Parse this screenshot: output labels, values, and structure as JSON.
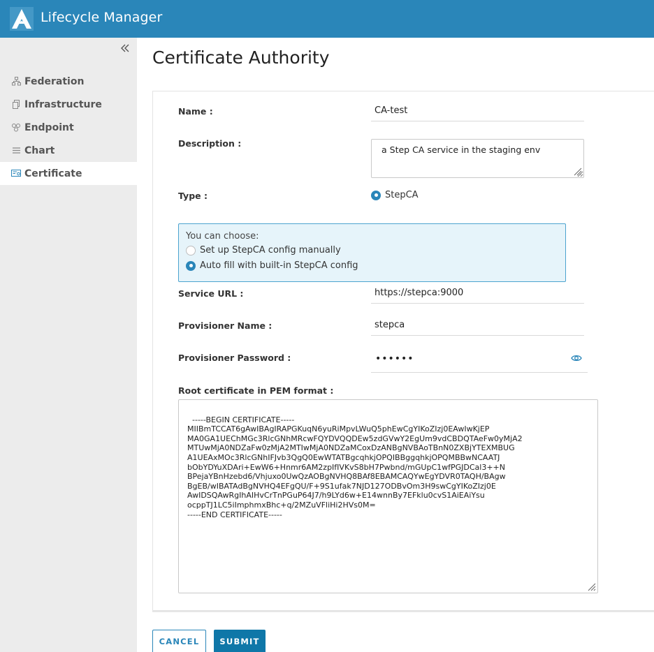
{
  "header": {
    "app_title": "Lifecycle Manager",
    "brand_color": "#2a86b9"
  },
  "sidebar": {
    "collapse_icon": "double-chevron-left-icon",
    "items": [
      {
        "label": "Federation",
        "icon": "hierarchy-icon",
        "active": false
      },
      {
        "label": "Infrastructure",
        "icon": "copy-icon",
        "active": false
      },
      {
        "label": "Endpoint",
        "icon": "endpoint-icon",
        "active": false
      },
      {
        "label": "Chart",
        "icon": "list-icon",
        "active": false
      },
      {
        "label": "Certificate",
        "icon": "certificate-icon",
        "active": true
      }
    ]
  },
  "page": {
    "title": "Certificate Authority"
  },
  "form": {
    "name_label": "Name :",
    "name_value": "CA-test",
    "description_label": "Description :",
    "description_value": "a Step CA service in the staging env",
    "type_label": "Type :",
    "type_option": "StepCA",
    "choose_title": "You can choose:",
    "choose_options": [
      {
        "label": "Set up StepCA config manually",
        "selected": false
      },
      {
        "label": "Auto fill with built-in StepCA config",
        "selected": true
      }
    ],
    "service_url_label": "Service URL :",
    "service_url_value": "https://stepca:9000",
    "provisioner_name_label": "Provisioner Name :",
    "provisioner_name_value": "stepca",
    "provisioner_password_label": "Provisioner Password :",
    "provisioner_password_value": "••••••",
    "root_cert_label": "Root certificate in PEM format :",
    "root_cert_value": "-----BEGIN CERTIFICATE-----\nMIIBmTCCAT6gAwIBAgIRAPGKuqN6yuRiMpvLWuQ5phEwCgYIKoZIzj0EAwIwKjEP\nMA0GA1UEChMGc3RlcGNhMRcwFQYDVQQDEw5zdGVwY2EgUm9vdCBDQTAeFw0yMjA2\nMTUwMjA0NDZaFw0zMjA2MTIwMjA0NDZaMCoxDzANBgNVBAoTBnN0ZXBjYTEXMBUG\nA1UEAxMOc3RlcGNhIFJvb3QgQ0EwWTATBgcqhkjOPQIBBggqhkjOPQMBBwNCAATJ\nbObYDYuXDAri+EwW6+Hnmr6AM2zpIfIVKvS8bH7Pwbnd/mGUpC1wfPGJDCal3++N\nBPejaYBnHzebd6/Vhjuxo0UwQzAOBgNVHQ8BAf8EBAMCAQYwEgYDVR0TAQH/BAgw\nBgEB/wIBATAdBgNVHQ4EFgQU/F+9S1ufak7NJD127ODBvOm3H9swCgYIKoZIzj0E\nAwIDSQAwRgIhAIHvCrTnPGuP64J7/h9LYd6w+E14wnnBy7EFklu0cvS1AiEAiYsu\nocppTJ1LC5iImphmxBhc+q/2MZuVFliHi2HVs0M=\n-----END CERTIFICATE-----"
  },
  "actions": {
    "cancel_label": "CANCEL",
    "submit_label": "SUBMIT"
  }
}
